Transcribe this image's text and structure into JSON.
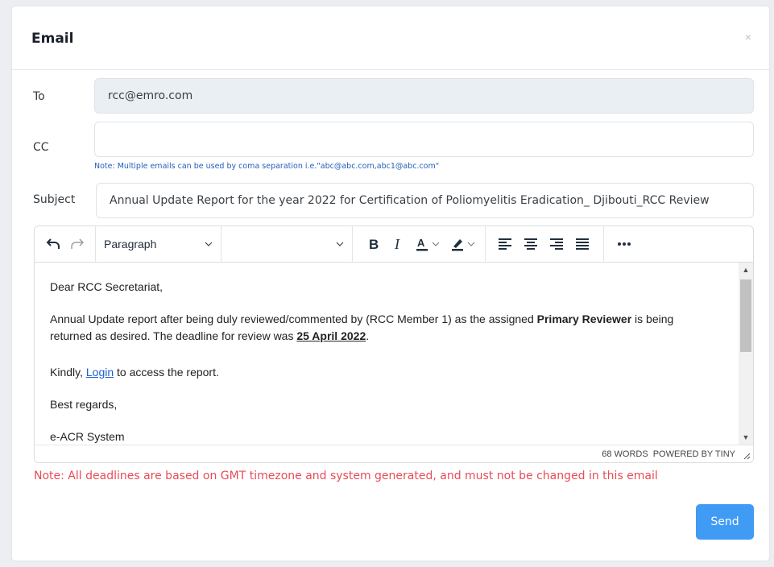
{
  "modal": {
    "title": "Email",
    "close_icon": "close-icon",
    "close_glyph": "×"
  },
  "form": {
    "to_label": "To",
    "to_value": "rcc@emro.com",
    "cc_label": "CC",
    "cc_value": "",
    "cc_hint": "Note: Multiple emails can be used by coma separation i.e.\"abc@abc.com,abc1@abc.com\"",
    "subject_label": "Subject",
    "subject_value": "Annual Update Report for the year 2022 for Certification of Poliomyelitis Eradication_ Djibouti_RCC Review"
  },
  "editor": {
    "toolbar": {
      "block_format": "Paragraph",
      "font_value": "",
      "icons": [
        "undo-icon",
        "redo-icon",
        "bold-icon",
        "italic-icon",
        "text-color-icon",
        "highlight-icon",
        "align-left-icon",
        "align-center-icon",
        "align-right-icon",
        "align-justify-icon",
        "more-icon"
      ]
    },
    "body": {
      "greeting": "Dear RCC Secretariat,",
      "para1_a": "Annual Update report after being duly reviewed/commented by (RCC Member 1) as the assigned ",
      "para1_bold": "Primary Reviewer",
      "para1_b": " is being returned as desired. The deadline for review was ",
      "para1_date": "25 April 2022",
      "para1_end": ".",
      "para2_a": "Kindly, ",
      "para2_link": "Login",
      "para2_b": " to access the report.",
      "closing": "Best regards,",
      "signature": "e-ACR System"
    },
    "status": {
      "word_count": "68 WORDS",
      "powered_by": "POWERED BY TINY"
    }
  },
  "footer": {
    "note": "Note: All deadlines are based on GMT timezone and system generated, and must not be changed in this email",
    "send_label": "Send",
    "note_color": "#e84c57",
    "send_color": "#3f9bf4"
  }
}
